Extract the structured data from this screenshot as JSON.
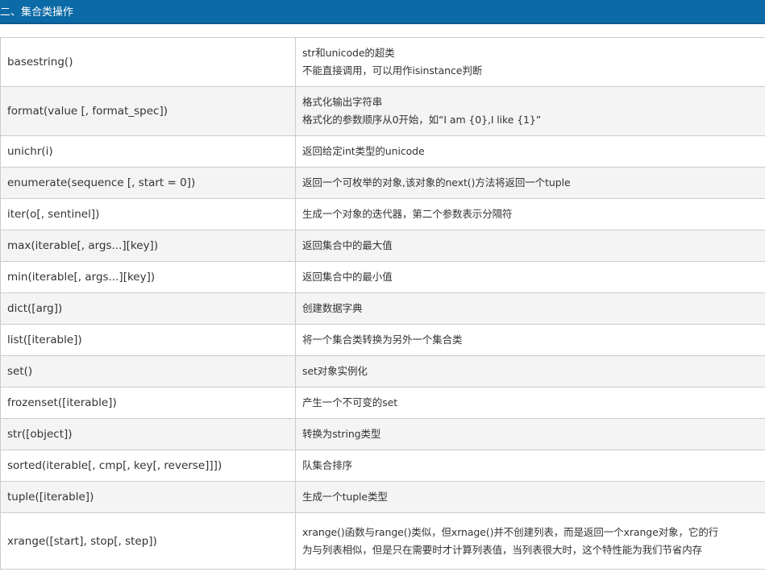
{
  "header": {
    "title": "二、集合类操作"
  },
  "table": {
    "rows": [
      {
        "func": "basestring()",
        "desc": [
          "str和unicode的超类",
          "不能直接调用，可以用作isinstance判断"
        ]
      },
      {
        "func": "format(value [, format_spec])",
        "desc": [
          "格式化输出字符串",
          "格式化的参数顺序从0开始，如“I am {0},I like {1}”"
        ]
      },
      {
        "func": "unichr(i)",
        "desc": [
          "返回给定int类型的unicode"
        ]
      },
      {
        "func": "enumerate(sequence [, start = 0])",
        "desc": [
          "返回一个可枚举的对象,该对象的next()方法将返回一个tuple"
        ]
      },
      {
        "func": "iter(o[, sentinel])",
        "desc": [
          "生成一个对象的迭代器，第二个参数表示分隔符"
        ]
      },
      {
        "func": "max(iterable[, args...][key])",
        "desc": [
          "返回集合中的最大值"
        ]
      },
      {
        "func": "min(iterable[, args...][key])",
        "desc": [
          "返回集合中的最小值"
        ]
      },
      {
        "func": "dict([arg])",
        "desc": [
          "创建数据字典"
        ]
      },
      {
        "func": "list([iterable])",
        "desc": [
          "将一个集合类转换为另外一个集合类"
        ]
      },
      {
        "func": "set()",
        "desc": [
          "set对象实例化"
        ]
      },
      {
        "func": "frozenset([iterable])",
        "desc": [
          "产生一个不可变的set"
        ]
      },
      {
        "func": "str([object])",
        "desc": [
          "转换为string类型"
        ]
      },
      {
        "func": "sorted(iterable[, cmp[, key[, reverse]]])",
        "desc": [
          "队集合排序"
        ]
      },
      {
        "func": "tuple([iterable])",
        "desc": [
          "生成一个tuple类型"
        ]
      },
      {
        "func": "xrange([start], stop[, step])",
        "desc": [
          "xrange()函数与range()类似，但xrnage()并不创建列表，而是返回一个xrange对象，它的行",
          "为与列表相似，但是只在需要时才计算列表值，当列表很大时，这个特性能为我们节省内存"
        ]
      }
    ]
  }
}
